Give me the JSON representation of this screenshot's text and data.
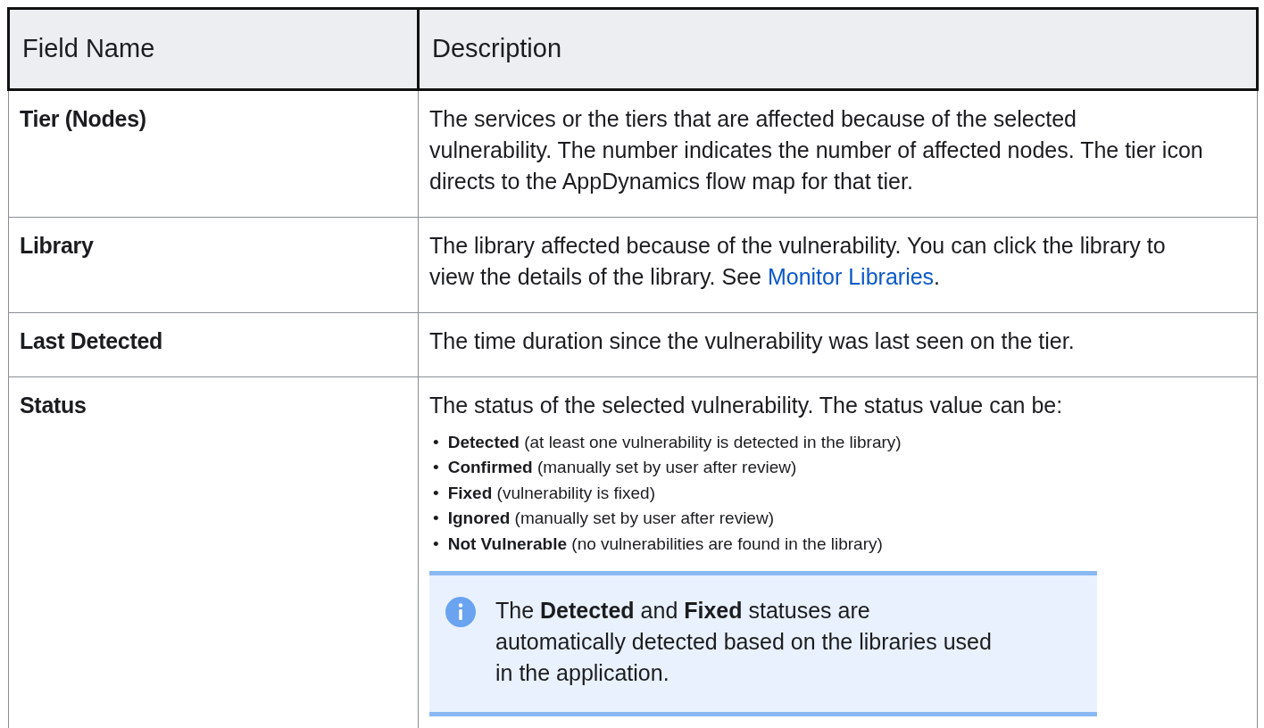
{
  "table": {
    "columns": [
      "Field Name",
      "Description"
    ],
    "rows": [
      {
        "field": "Tier (Nodes)",
        "description": [
          {
            "kind": "text",
            "text": "The services or the tiers that are affected because of the selected vulnerability. The number indicates the number of affected nodes. The tier icon directs to the AppDynamics flow map for that tier."
          }
        ]
      },
      {
        "field": "Library",
        "description": [
          {
            "kind": "linked",
            "before": "The library affected because of the vulnerability. You can click the library to view the details of the library. See ",
            "link": "Monitor Libraries",
            "after": "."
          }
        ]
      },
      {
        "field": "Last Detected",
        "description": [
          {
            "kind": "text",
            "text": "The time duration since the vulnerability was last seen on the tier."
          }
        ]
      },
      {
        "field": "Status",
        "description": [
          {
            "kind": "text",
            "text": "The status of the selected vulnerability. The status value can be:"
          },
          {
            "kind": "list",
            "items": [
              {
                "marker": "•",
                "text": "**Detected** (at least one vulnerability is detected in the library)"
              },
              {
                "marker": "•",
                "text": "**Confirmed** (manually set by user after review)"
              },
              {
                "marker": "•",
                "text": "**Fixed** (vulnerability is fixed)"
              },
              {
                "marker": "•",
                "text": "**Ignored** (manually set by user after review)"
              },
              {
                "marker": "•",
                "text": "**Not Vulnerable** (no vulnerabilities are found in the library)"
              }
            ]
          },
          {
            "kind": "note",
            "text": "The **Detected** and **Fixed** statuses are automatically detected based on the libraries used in the application."
          }
        ]
      }
    ]
  }
}
